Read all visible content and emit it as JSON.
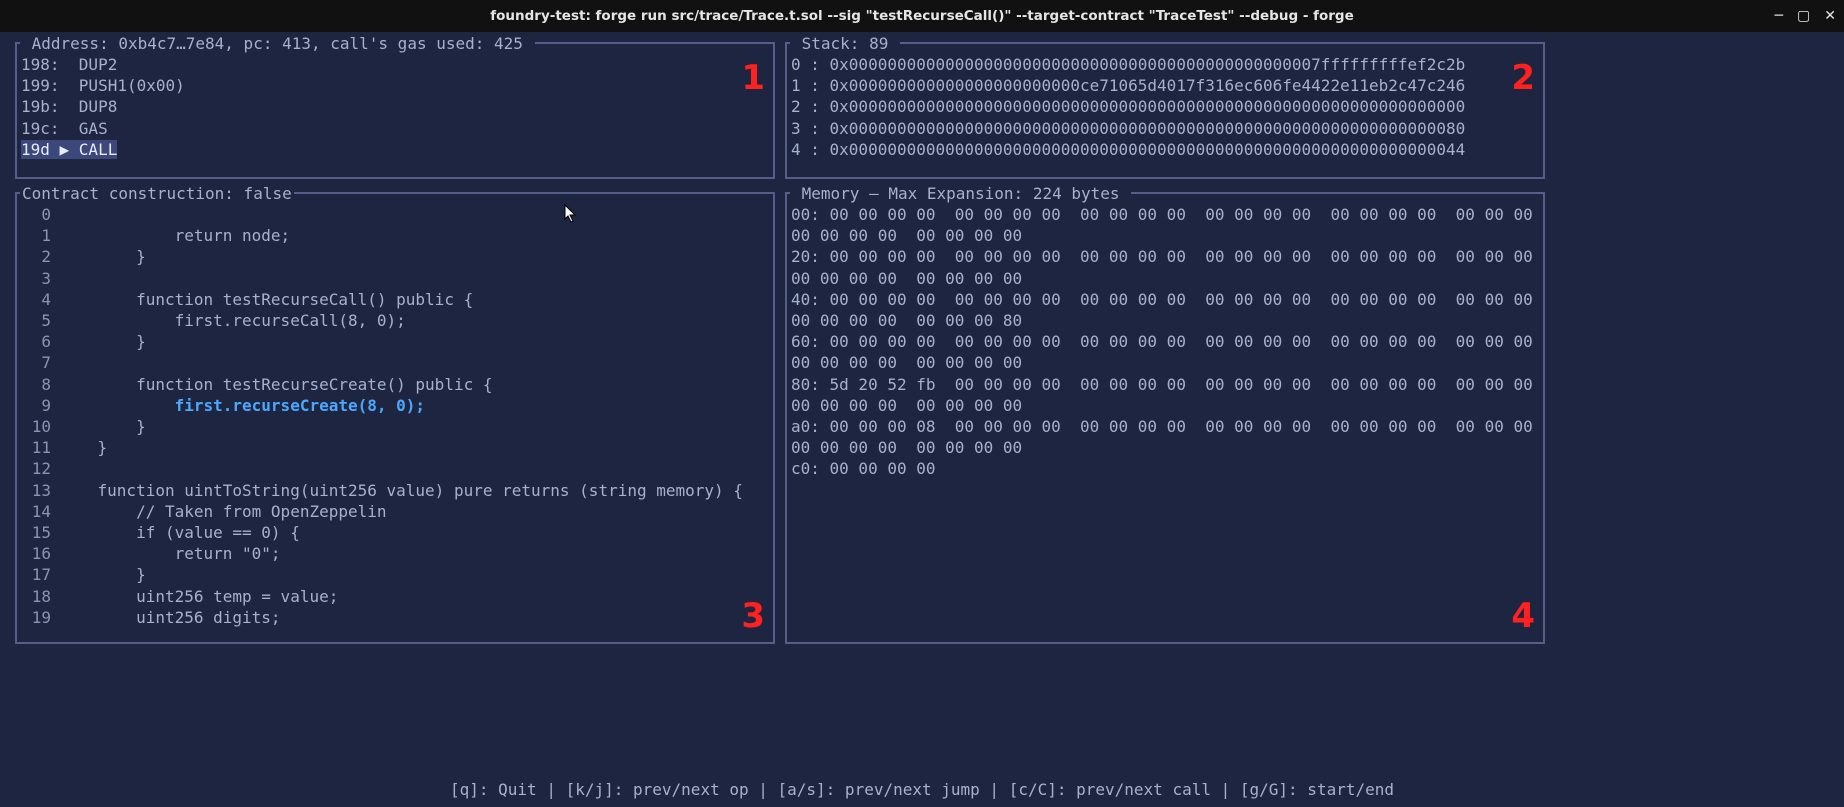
{
  "window": {
    "title": "foundry-test: forge run src/trace/Trace.t.sol --sig \"testRecurseCall()\" --target-contract \"TraceTest\" --debug - forge"
  },
  "colors": {
    "bg": "#1e2540",
    "border": "#555d8a",
    "text": "#a7b0cc",
    "highlight_bg": "#3c477a",
    "accent": "#4aa8ff",
    "red": "#ff2020"
  },
  "pane_opcodes": {
    "title": " Address: 0xb4c7…7e84, pc: 413, call's gas used: 425 ",
    "pane_num": "1",
    "rows": [
      {
        "addr": "198:",
        "op": "DUP2",
        "current": false
      },
      {
        "addr": "199:",
        "op": "PUSH1(0x00)",
        "current": false
      },
      {
        "addr": "19b:",
        "op": "DUP8",
        "current": false
      },
      {
        "addr": "19c:",
        "op": "GAS",
        "current": false
      },
      {
        "addr": "19d",
        "op": "CALL",
        "current": true,
        "marker": "▶"
      }
    ]
  },
  "pane_source": {
    "title": "Contract construction: false",
    "pane_num": "3",
    "lines": [
      {
        "n": "0",
        "text": ""
      },
      {
        "n": "1",
        "text": "            return node;"
      },
      {
        "n": "2",
        "text": "        }"
      },
      {
        "n": "3",
        "text": ""
      },
      {
        "n": "4",
        "text": "        function testRecurseCall() public {"
      },
      {
        "n": "5",
        "text": "            first.recurseCall(8, 0);"
      },
      {
        "n": "6",
        "text": "        }"
      },
      {
        "n": "7",
        "text": ""
      },
      {
        "n": "8",
        "text": "        function testRecurseCreate() public {"
      },
      {
        "n": "9",
        "text": "            ",
        "hl": "first.recurseCreate(8, 0);"
      },
      {
        "n": "10",
        "text": "        }"
      },
      {
        "n": "11",
        "text": "    }"
      },
      {
        "n": "12",
        "text": ""
      },
      {
        "n": "13",
        "text": "    function uintToString(uint256 value) pure returns (string memory) {"
      },
      {
        "n": "14",
        "text": "        // Taken from OpenZeppelin"
      },
      {
        "n": "15",
        "text": "        if (value == 0) {"
      },
      {
        "n": "16",
        "text": "            return \"0\";"
      },
      {
        "n": "17",
        "text": "        }"
      },
      {
        "n": "18",
        "text": "        uint256 temp = value;"
      },
      {
        "n": "19",
        "text": "        uint256 digits;"
      }
    ]
  },
  "pane_stack": {
    "title": " Stack: 89 ",
    "pane_num": "2",
    "rows": [
      {
        "idx": "0 :",
        "val": "0x0000000000000000000000000000000000000000000000007fffffffffef2c2b"
      },
      {
        "idx": "1 :",
        "val": "0x000000000000000000000000ce71065d4017f316ec606fe4422e11eb2c47c246"
      },
      {
        "idx": "2 :",
        "val": "0x0000000000000000000000000000000000000000000000000000000000000000"
      },
      {
        "idx": "3 :",
        "val": "0x0000000000000000000000000000000000000000000000000000000000000080"
      },
      {
        "idx": "4 :",
        "val": "0x0000000000000000000000000000000000000000000000000000000000000044"
      }
    ]
  },
  "pane_memory": {
    "title": " Memory – Max Expansion: 224 bytes ",
    "pane_num": "4",
    "rows": [
      "00: 00 00 00 00  00 00 00 00  00 00 00 00  00 00 00 00  00 00 00 00  00 00 00 00  ",
      "00 00 00 00  00 00 00 00",
      "20: 00 00 00 00  00 00 00 00  00 00 00 00  00 00 00 00  00 00 00 00  00 00 00 00  ",
      "00 00 00 00  00 00 00 00",
      "40: 00 00 00 00  00 00 00 00  00 00 00 00  00 00 00 00  00 00 00 00  00 00 00 00  ",
      "00 00 00 00  00 00 00 80",
      "60: 00 00 00 00  00 00 00 00  00 00 00 00  00 00 00 00  00 00 00 00  00 00 00 00  ",
      "00 00 00 00  00 00 00 00",
      "80: 5d 20 52 fb  00 00 00 00  00 00 00 00  00 00 00 00  00 00 00 00  00 00 00 00  ",
      "00 00 00 00  00 00 00 00",
      "a0: 00 00 00 08  00 00 00 00  00 00 00 00  00 00 00 00  00 00 00 00  00 00 00 00  ",
      "00 00 00 00  00 00 00 00",
      "c0: 00 00 00 00"
    ]
  },
  "footer": {
    "text": "[q]: Quit | [k/j]: prev/next op | [a/s]: prev/next jump | [c/C]: prev/next call | [g/G]: start/end"
  }
}
